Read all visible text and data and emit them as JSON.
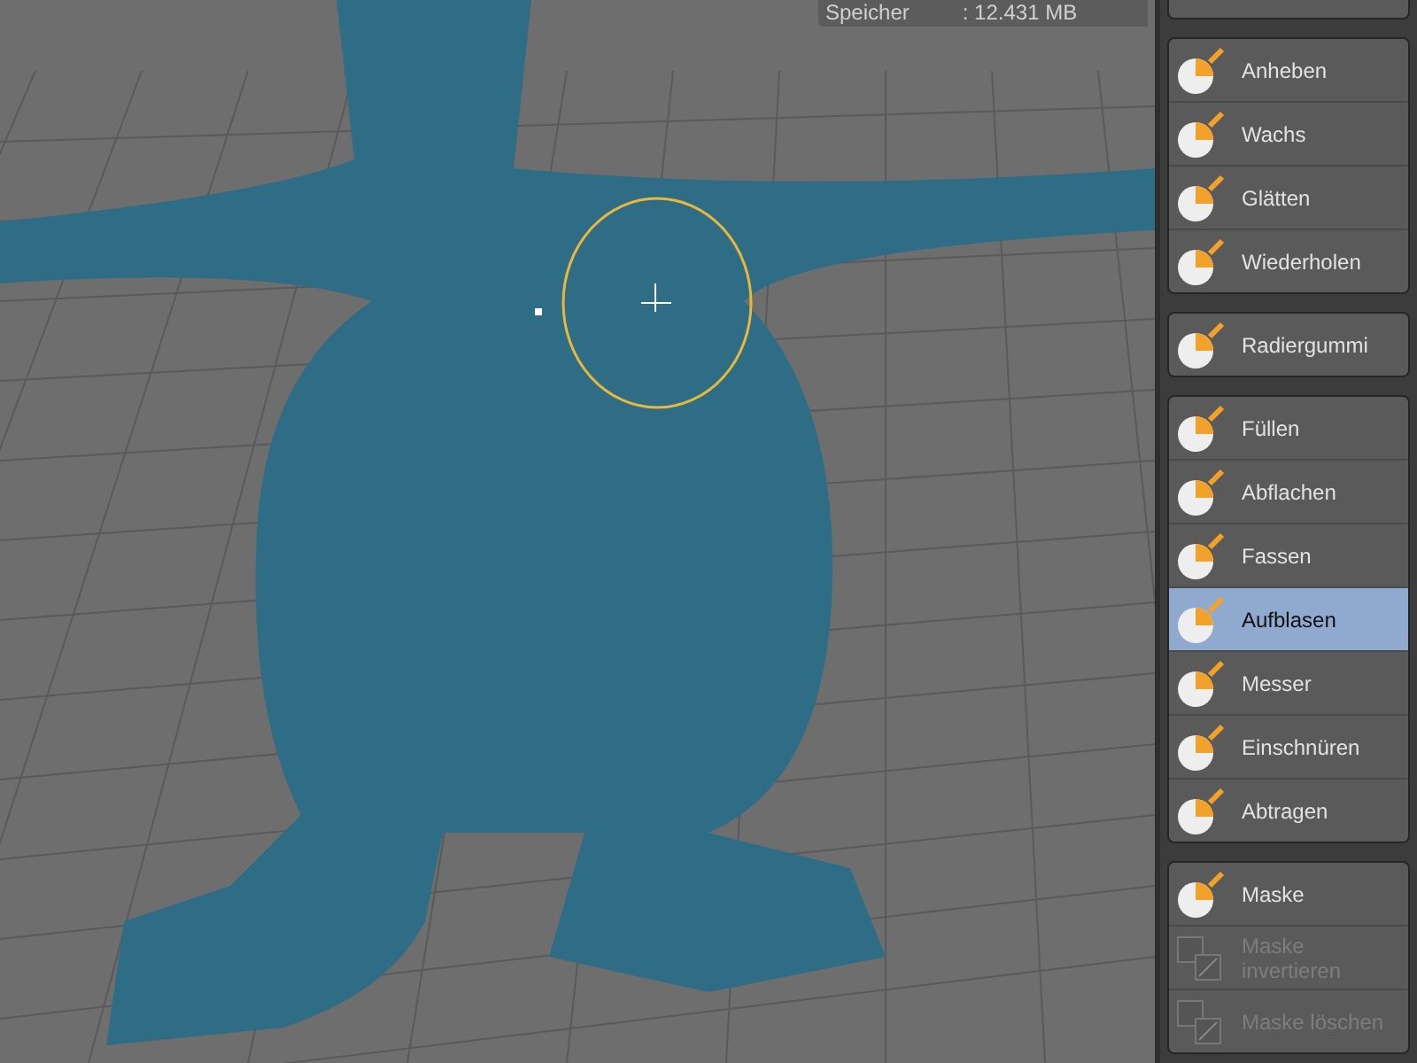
{
  "viewport": {
    "info": {
      "label": "Speicher",
      "value": ": 12.431 MB"
    }
  },
  "tool_groups": [
    {
      "items": [
        {
          "label": "Anheben",
          "selected": false,
          "disabled": false
        },
        {
          "label": "Wachs",
          "selected": false,
          "disabled": false
        },
        {
          "label": "Glätten",
          "selected": false,
          "disabled": false
        },
        {
          "label": "Wiederholen",
          "selected": false,
          "disabled": false
        }
      ]
    },
    {
      "items": [
        {
          "label": "Radiergummi",
          "selected": false,
          "disabled": false
        }
      ]
    },
    {
      "items": [
        {
          "label": "Füllen",
          "selected": false,
          "disabled": false
        },
        {
          "label": "Abflachen",
          "selected": false,
          "disabled": false
        },
        {
          "label": "Fassen",
          "selected": false,
          "disabled": false
        },
        {
          "label": "Aufblasen",
          "selected": true,
          "disabled": false
        },
        {
          "label": "Messer",
          "selected": false,
          "disabled": false
        },
        {
          "label": "Einschnüren",
          "selected": false,
          "disabled": false
        },
        {
          "label": "Abtragen",
          "selected": false,
          "disabled": false
        }
      ]
    },
    {
      "items": [
        {
          "label": "Maske",
          "selected": false,
          "disabled": false
        },
        {
          "label": "Maske invertieren",
          "selected": false,
          "disabled": true
        },
        {
          "label": "Maske löschen",
          "selected": false,
          "disabled": true
        }
      ]
    }
  ]
}
